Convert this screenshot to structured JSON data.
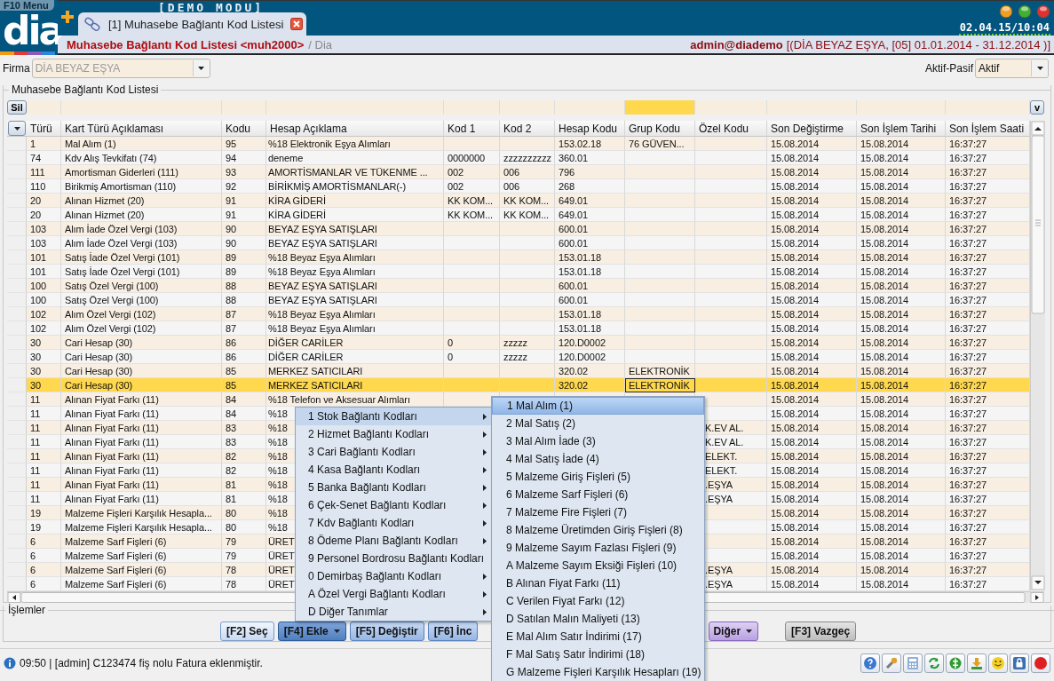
{
  "header": {
    "menu_label": "F10 Menu",
    "logo": "dia",
    "mode": "[DEMO MODU]",
    "clock": "02.04.15/10:04",
    "tabs": [
      {
        "label": "[1] Muhasebe Bağlantı Kod Listesi",
        "selected": true
      }
    ]
  },
  "title_bar": {
    "title": "Muhasebe Bağlantı Kod Listesi <muh2000>",
    "path": "/ Dia",
    "user": "admin@diademo",
    "context": "[(DİA BEYAZ EŞYA, [05] 01.01.2014 - 31.12.2014 )]"
  },
  "firma": {
    "label": "Firma",
    "value": "DİA BEYAZ EŞYA",
    "disabled": true
  },
  "aktif_pasif": {
    "label": "Aktif-Pasif",
    "value": "Aktif"
  },
  "list": {
    "title": "Muhasebe Bağlantı Kod Listesi",
    "delete_button": "Sil",
    "filter_toggle": "v",
    "columns": [
      {
        "label": "Türü",
        "filter_active": false
      },
      {
        "label": "Kart Türü Açıklaması",
        "filter_active": false
      },
      {
        "label": "Kodu",
        "filter_active": false
      },
      {
        "label": "Hesap Açıklama",
        "filter_active": false
      },
      {
        "label": "Kod 1",
        "filter_active": false
      },
      {
        "label": "Kod 2",
        "filter_active": false
      },
      {
        "label": "Hesap Kodu",
        "filter_active": false
      },
      {
        "label": "Grup Kodu",
        "filter_active": true,
        "current": true
      },
      {
        "label": "Özel Kodu",
        "filter_active": false
      },
      {
        "label": "Son Değiştirme",
        "filter_active": false
      },
      {
        "label": "Son İşlem Tarihi",
        "filter_active": false
      },
      {
        "label": "Son İşlem Saati",
        "filter_active": false
      }
    ],
    "rows": [
      {
        "turu": "1",
        "kart_turu": "Mal Alım (1)",
        "kodu": "95",
        "hesap_aciklama": "%18 Elektronik Eşya Alımları",
        "hesap_kodu": "153.02.18",
        "grup_kodu": "76 GÜVEN...",
        "son_degistirme": "15.08.2014",
        "son_islem_tarihi": "15.08.2014",
        "son_islem_saati": "16:37:27",
        "selected": false
      },
      {
        "turu": "74",
        "kart_turu": "Kdv Alış Tevkifatı (74)",
        "kodu": "94",
        "hesap_aciklama": "deneme",
        "kod_1": "0000000",
        "kod_2": "zzzzzzzzzz",
        "hesap_kodu": "360.01",
        "son_degistirme": "15.08.2014",
        "son_islem_tarihi": "15.08.2014",
        "son_islem_saati": "16:37:27",
        "selected": false
      },
      {
        "turu": "111",
        "kart_turu": "Amortisman Giderleri (111)",
        "kodu": "93",
        "hesap_aciklama": "AMORTİSMANLAR VE TÜKENME ...",
        "kod_1": "002",
        "kod_2": "006",
        "hesap_kodu": "796",
        "son_degistirme": "15.08.2014",
        "son_islem_tarihi": "15.08.2014",
        "son_islem_saati": "16:37:27",
        "selected": false
      },
      {
        "turu": "110",
        "kart_turu": "Birikmiş Amortisman (110)",
        "kodu": "92",
        "hesap_aciklama": "BİRİKMİŞ AMORTİSMANLAR(-)",
        "kod_1": "002",
        "kod_2": "006",
        "hesap_kodu": "268",
        "son_degistirme": "15.08.2014",
        "son_islem_tarihi": "15.08.2014",
        "son_islem_saati": "16:37:27",
        "selected": false
      },
      {
        "turu": "20",
        "kart_turu": "Alınan Hizmet (20)",
        "kodu": "91",
        "hesap_aciklama": "KİRA GİDERİ",
        "kod_1": "KK KOM...",
        "kod_2": "KK KOM...",
        "hesap_kodu": "649.01",
        "son_degistirme": "15.08.2014",
        "son_islem_tarihi": "15.08.2014",
        "son_islem_saati": "16:37:27",
        "selected": false
      },
      {
        "turu": "20",
        "kart_turu": "Alınan Hizmet (20)",
        "kodu": "91",
        "hesap_aciklama": "KİRA GİDERİ",
        "kod_1": "KK KOM...",
        "kod_2": "KK KOM...",
        "hesap_kodu": "649.01",
        "son_degistirme": "15.08.2014",
        "son_islem_tarihi": "15.08.2014",
        "son_islem_saati": "16:37:27",
        "selected": false
      },
      {
        "turu": "103",
        "kart_turu": "Alım İade Özel Vergi (103)",
        "kodu": "90",
        "hesap_aciklama": "BEYAZ EŞYA SATIŞLARI",
        "hesap_kodu": "600.01",
        "son_degistirme": "15.08.2014",
        "son_islem_tarihi": "15.08.2014",
        "son_islem_saati": "16:37:27",
        "selected": false
      },
      {
        "turu": "103",
        "kart_turu": "Alım İade Özel Vergi (103)",
        "kodu": "90",
        "hesap_aciklama": "BEYAZ EŞYA SATIŞLARI",
        "hesap_kodu": "600.01",
        "son_degistirme": "15.08.2014",
        "son_islem_tarihi": "15.08.2014",
        "son_islem_saati": "16:37:27",
        "selected": false
      },
      {
        "turu": "101",
        "kart_turu": "Satış İade Özel Vergi (101)",
        "kodu": "89",
        "hesap_aciklama": "%18 Beyaz Eşya Alımları",
        "hesap_kodu": "153.01.18",
        "son_degistirme": "15.08.2014",
        "son_islem_tarihi": "15.08.2014",
        "son_islem_saati": "16:37:27",
        "selected": false
      },
      {
        "turu": "101",
        "kart_turu": "Satış İade Özel Vergi (101)",
        "kodu": "89",
        "hesap_aciklama": "%18 Beyaz Eşya Alımları",
        "hesap_kodu": "153.01.18",
        "son_degistirme": "15.08.2014",
        "son_islem_tarihi": "15.08.2014",
        "son_islem_saati": "16:37:27",
        "selected": false
      },
      {
        "turu": "100",
        "kart_turu": "Satış Özel Vergi (100)",
        "kodu": "88",
        "hesap_aciklama": "BEYAZ EŞYA SATIŞLARI",
        "hesap_kodu": "600.01",
        "son_degistirme": "15.08.2014",
        "son_islem_tarihi": "15.08.2014",
        "son_islem_saati": "16:37:27",
        "selected": false
      },
      {
        "turu": "100",
        "kart_turu": "Satış Özel Vergi (100)",
        "kodu": "88",
        "hesap_aciklama": "BEYAZ EŞYA SATIŞLARI",
        "hesap_kodu": "600.01",
        "son_degistirme": "15.08.2014",
        "son_islem_tarihi": "15.08.2014",
        "son_islem_saati": "16:37:27",
        "selected": false
      },
      {
        "turu": "102",
        "kart_turu": "Alım Özel Vergi (102)",
        "kodu": "87",
        "hesap_aciklama": "%18 Beyaz Eşya Alımları",
        "hesap_kodu": "153.01.18",
        "son_degistirme": "15.08.2014",
        "son_islem_tarihi": "15.08.2014",
        "son_islem_saati": "16:37:27",
        "selected": false
      },
      {
        "turu": "102",
        "kart_turu": "Alım Özel Vergi (102)",
        "kodu": "87",
        "hesap_aciklama": "%18 Beyaz Eşya Alımları",
        "hesap_kodu": "153.01.18",
        "son_degistirme": "15.08.2014",
        "son_islem_tarihi": "15.08.2014",
        "son_islem_saati": "16:37:27",
        "selected": false
      },
      {
        "turu": "30",
        "kart_turu": "Cari Hesap (30)",
        "kodu": "86",
        "hesap_aciklama": "DİĞER CARİLER",
        "kod_1": "0",
        "kod_2": "zzzzz",
        "hesap_kodu": "120.D0002",
        "son_degistirme": "15.08.2014",
        "son_islem_tarihi": "15.08.2014",
        "son_islem_saati": "16:37:27",
        "selected": false
      },
      {
        "turu": "30",
        "kart_turu": "Cari Hesap (30)",
        "kodu": "86",
        "hesap_aciklama": "DİĞER CARİLER",
        "kod_1": "0",
        "kod_2": "zzzzz",
        "hesap_kodu": "120.D0002",
        "son_degistirme": "15.08.2014",
        "son_islem_tarihi": "15.08.2014",
        "son_islem_saati": "16:37:27",
        "selected": false
      },
      {
        "turu": "30",
        "kart_turu": "Cari Hesap (30)",
        "kodu": "85",
        "hesap_aciklama": "MERKEZ SATICILARI",
        "hesap_kodu": "320.02",
        "grup_kodu": "ELEKTRONİK",
        "son_degistirme": "15.08.2014",
        "son_islem_tarihi": "15.08.2014",
        "son_islem_saati": "16:37:27",
        "selected": false
      },
      {
        "turu": "30",
        "kart_turu": "Cari Hesap (30)",
        "kodu": "85",
        "hesap_aciklama": "MERKEZ SATICILARI",
        "hesap_kodu": "320.02",
        "grup_kodu": "ELEKTRONİK",
        "son_degistirme": "15.08.2014",
        "son_islem_tarihi": "15.08.2014",
        "son_islem_saati": "16:37:27",
        "selected": true
      },
      {
        "turu": "11",
        "kart_turu": "Alınan Fiyat Farkı (11)",
        "kodu": "84",
        "hesap_aciklama": "%18 Telefon ve Aksesuar Alımları",
        "son_degistirme": "15.08.2014",
        "son_islem_tarihi": "15.08.2014",
        "son_islem_saati": "16:37:27",
        "selected": false
      },
      {
        "turu": "11",
        "kart_turu": "Alınan Fiyat Farkı (11)",
        "kodu": "84",
        "hesap_aciklama": "%18",
        "son_degistirme": "15.08.2014",
        "son_islem_tarihi": "15.08.2014",
        "son_islem_saati": "16:37:27",
        "selected": false
      },
      {
        "turu": "11",
        "kart_turu": "Alınan Fiyat Farkı (11)",
        "kodu": "83",
        "hesap_aciklama": "%18",
        "ozel_kodu": "K.EV AL.",
        "son_degistirme": "15.08.2014",
        "son_islem_tarihi": "15.08.2014",
        "son_islem_saati": "16:37:27",
        "selected": false
      },
      {
        "turu": "11",
        "kart_turu": "Alınan Fiyat Farkı (11)",
        "kodu": "83",
        "hesap_aciklama": "%18",
        "ozel_kodu": "K.EV AL.",
        "son_degistirme": "15.08.2014",
        "son_islem_tarihi": "15.08.2014",
        "son_islem_saati": "16:37:27",
        "selected": false
      },
      {
        "turu": "11",
        "kart_turu": "Alınan Fiyat Farkı (11)",
        "kodu": "82",
        "hesap_aciklama": "%18",
        "ozel_kodu": "ELEKT.",
        "son_degistirme": "15.08.2014",
        "son_islem_tarihi": "15.08.2014",
        "son_islem_saati": "16:37:27",
        "selected": false
      },
      {
        "turu": "11",
        "kart_turu": "Alınan Fiyat Farkı (11)",
        "kodu": "82",
        "hesap_aciklama": "%18",
        "ozel_kodu": "ELEKT.",
        "son_degistirme": "15.08.2014",
        "son_islem_tarihi": "15.08.2014",
        "son_islem_saati": "16:37:27",
        "selected": false
      },
      {
        "turu": "11",
        "kart_turu": "Alınan Fiyat Farkı (11)",
        "kodu": "81",
        "hesap_aciklama": "%18",
        "ozel_kodu": ".EŞYA",
        "son_degistirme": "15.08.2014",
        "son_islem_tarihi": "15.08.2014",
        "son_islem_saati": "16:37:27",
        "selected": false
      },
      {
        "turu": "11",
        "kart_turu": "Alınan Fiyat Farkı (11)",
        "kodu": "81",
        "hesap_aciklama": "%18",
        "ozel_kodu": ".EŞYA",
        "son_degistirme": "15.08.2014",
        "son_islem_tarihi": "15.08.2014",
        "son_islem_saati": "16:37:27",
        "selected": false
      },
      {
        "turu": "19",
        "kart_turu": "Malzeme Fişleri Karşılık Hesapla...",
        "kodu": "80",
        "hesap_aciklama": "%18",
        "son_degistirme": "15.08.2014",
        "son_islem_tarihi": "15.08.2014",
        "son_islem_saati": "16:37:27",
        "selected": false
      },
      {
        "turu": "19",
        "kart_turu": "Malzeme Fişleri Karşılık Hesapla...",
        "kodu": "80",
        "hesap_aciklama": "%18",
        "son_degistirme": "15.08.2014",
        "son_islem_tarihi": "15.08.2014",
        "son_islem_saati": "16:37:27",
        "selected": false
      },
      {
        "turu": "6",
        "kart_turu": "Malzeme Sarf Fişleri (6)",
        "kodu": "79",
        "hesap_aciklama": "ÜRET",
        "son_degistirme": "15.08.2014",
        "son_islem_tarihi": "15.08.2014",
        "son_islem_saati": "16:37:27",
        "selected": false
      },
      {
        "turu": "6",
        "kart_turu": "Malzeme Sarf Fişleri (6)",
        "kodu": "79",
        "hesap_aciklama": "ÜRET",
        "son_degistirme": "15.08.2014",
        "son_islem_tarihi": "15.08.2014",
        "son_islem_saati": "16:37:27",
        "selected": false
      },
      {
        "turu": "6",
        "kart_turu": "Malzeme Sarf Fişleri (6)",
        "kodu": "78",
        "hesap_aciklama": "ÜRET",
        "ozel_kodu": ".EŞYA",
        "son_degistirme": "15.08.2014",
        "son_islem_tarihi": "15.08.2014",
        "son_islem_saati": "16:37:27",
        "selected": false
      },
      {
        "turu": "6",
        "kart_turu": "Malzeme Sarf Fişleri (6)",
        "kodu": "78",
        "hesap_aciklama": "ÜRET",
        "ozel_kodu": ".EŞYA",
        "son_degistirme": "15.08.2014",
        "son_islem_tarihi": "15.08.2014",
        "son_islem_saati": "16:37:27",
        "selected": false
      }
    ]
  },
  "menu": {
    "items": [
      {
        "label": "1 Stok Bağlantı Kodları",
        "submenu": true,
        "selected": true
      },
      {
        "label": "2 Hizmet Bağlantı Kodları",
        "submenu": true,
        "selected": false
      },
      {
        "label": "3 Cari Bağlantı Kodları",
        "submenu": true,
        "selected": false
      },
      {
        "label": "4 Kasa Bağlantı Kodları",
        "submenu": true,
        "selected": false
      },
      {
        "label": "5 Banka Bağlantı Kodları",
        "submenu": true,
        "selected": false
      },
      {
        "label": "6 Çek-Senet Bağlantı Kodları",
        "submenu": true,
        "selected": false
      },
      {
        "label": "7 Kdv Bağlantı Kodları",
        "submenu": true,
        "selected": false
      },
      {
        "label": "8 Ödeme Planı Bağlantı Kodları",
        "submenu": true,
        "selected": false
      },
      {
        "label": "9 Personel Bordrosu Bağlantı Kodları",
        "submenu": false,
        "selected": false
      },
      {
        "label": "0 Demirbaş Bağlantı Kodları",
        "submenu": true,
        "selected": false
      },
      {
        "label": "A Özel Vergi Bağlantı Kodları",
        "submenu": true,
        "selected": false
      },
      {
        "label": "D Diğer Tanımlar",
        "submenu": true,
        "selected": false
      }
    ]
  },
  "submenu": {
    "items": [
      {
        "label": "1 Mal Alım (1)",
        "selected": true
      },
      {
        "label": "2 Mal Satış (2)",
        "selected": false
      },
      {
        "label": "3 Mal Alım İade (3)",
        "selected": false
      },
      {
        "label": "4 Mal Satış İade (4)",
        "selected": false
      },
      {
        "label": "5 Malzeme Giriş Fişleri (5)",
        "selected": false
      },
      {
        "label": "6 Malzeme Sarf Fişleri (6)",
        "selected": false
      },
      {
        "label": "7 Malzeme Fire Fişleri (7)",
        "selected": false
      },
      {
        "label": "8 Malzeme Üretimden Giriş Fişleri (8)",
        "selected": false
      },
      {
        "label": "9 Malzeme Sayım Fazlası Fişleri (9)",
        "selected": false
      },
      {
        "label": "A Malzeme Sayım Eksiği Fişleri (10)",
        "selected": false
      },
      {
        "label": "B Alınan Fiyat Farkı (11)",
        "selected": false
      },
      {
        "label": "C Verilen Fiyat Farkı (12)",
        "selected": false
      },
      {
        "label": "D Satılan Malın Maliyeti (13)",
        "selected": false
      },
      {
        "label": "E Mal Alım Satır İndirimi (17)",
        "selected": false
      },
      {
        "label": "F Mal Satış Satır İndirimi (18)",
        "selected": false
      },
      {
        "label": "G Malzeme Fişleri Karşılık Hesapları (19)",
        "selected": false
      }
    ]
  },
  "actions": {
    "title": "İşlemler",
    "buttons": [
      {
        "label": "[F2] Seç",
        "kind": "light",
        "dropdown": false
      },
      {
        "label": "[F4] Ekle",
        "kind": "pressed",
        "dropdown": true
      },
      {
        "label": "[F5] Değiştir",
        "kind": "blue",
        "dropdown": false
      },
      {
        "label": "[F6] İnc",
        "kind": "blue",
        "dropdown": false
      },
      {
        "label": "Diğer",
        "kind": "purple",
        "dropdown": true
      },
      {
        "label": "[F3] Vazgeç",
        "kind": "grey",
        "dropdown": false
      }
    ]
  },
  "status_bar": {
    "message": "09:50 | [admin] C123474 fiş nolu Fatura eklenmiştir."
  }
}
